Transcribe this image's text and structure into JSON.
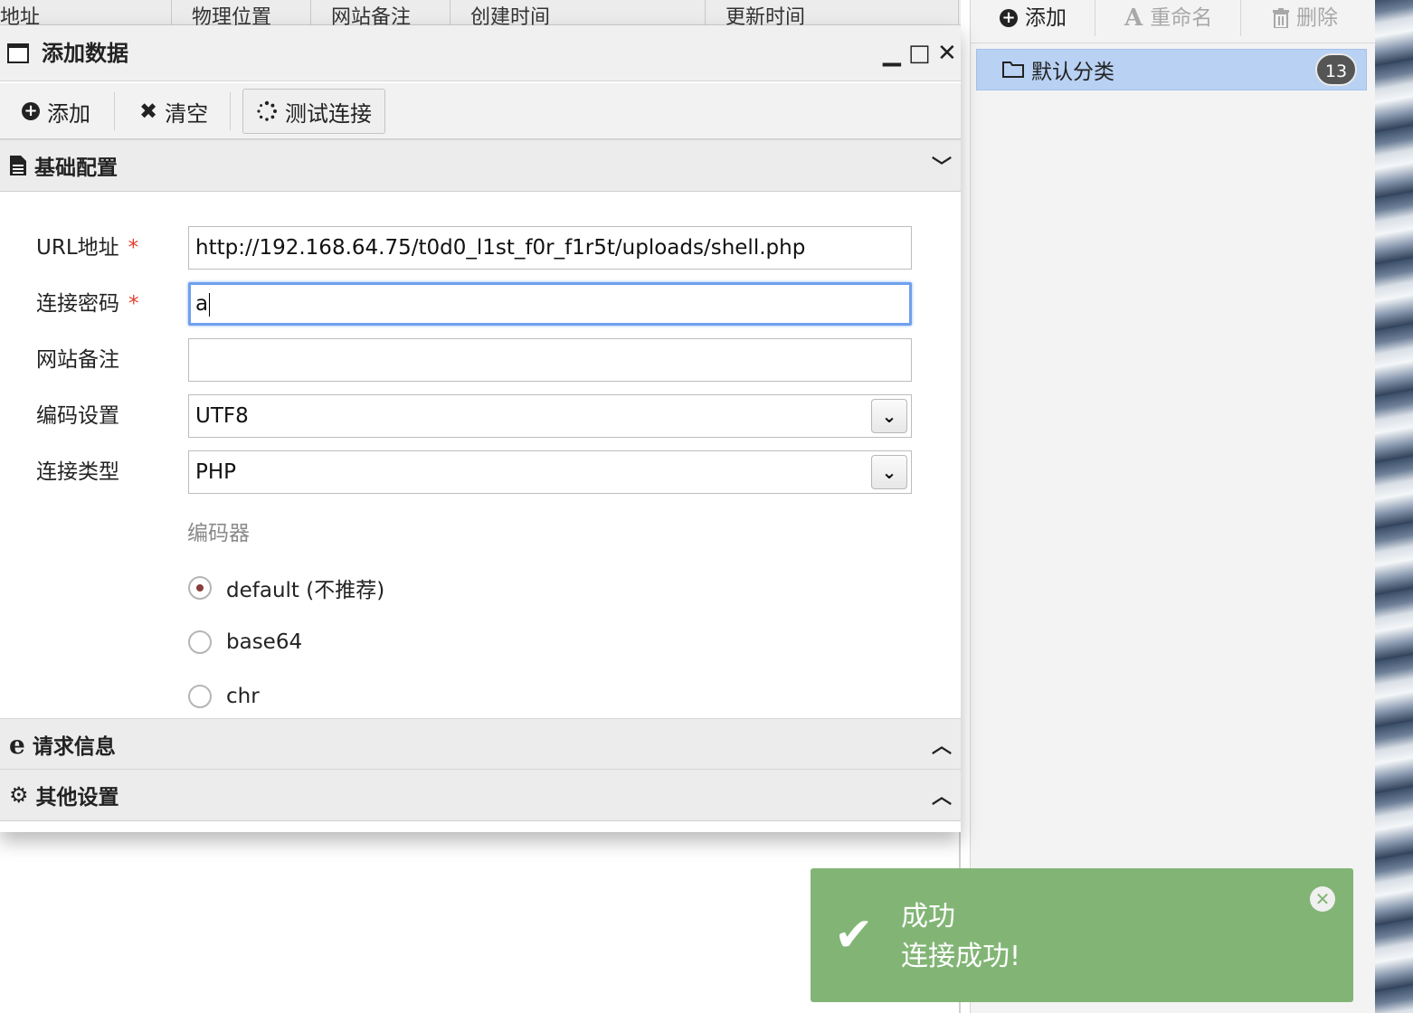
{
  "background_table": {
    "columns": [
      "地址",
      "物理位置",
      "网站备注",
      "创建时间",
      "更新时间"
    ]
  },
  "dialog": {
    "title": "添加数据",
    "controls": {
      "minimize": "▁",
      "maximize": "□",
      "close": "✕"
    },
    "toolbar": {
      "add": "添加",
      "clear": "清空",
      "test": "测试连接"
    },
    "sections": {
      "basic": "基础配置",
      "request": "请求信息",
      "other": "其他设置"
    },
    "form": {
      "url_label": "URL地址",
      "url_value": "http://192.168.64.75/t0d0_l1st_f0r_f1r5t/uploads/shell.php",
      "password_label": "连接密码",
      "password_value": "a",
      "note_label": "网站备注",
      "note_value": "",
      "encoding_label": "编码设置",
      "encoding_value": "UTF8",
      "type_label": "连接类型",
      "type_value": "PHP",
      "required_mark": "*"
    },
    "encoder": {
      "title": "编码器",
      "options": [
        "default (不推荐)",
        "base64",
        "chr"
      ],
      "selected_index": 0
    }
  },
  "category_panel": {
    "add": "添加",
    "rename": "重命名",
    "delete": "删除",
    "items": [
      {
        "label": "默认分类",
        "count": "13"
      }
    ]
  },
  "toast": {
    "title": "成功",
    "message": "连接成功!"
  }
}
